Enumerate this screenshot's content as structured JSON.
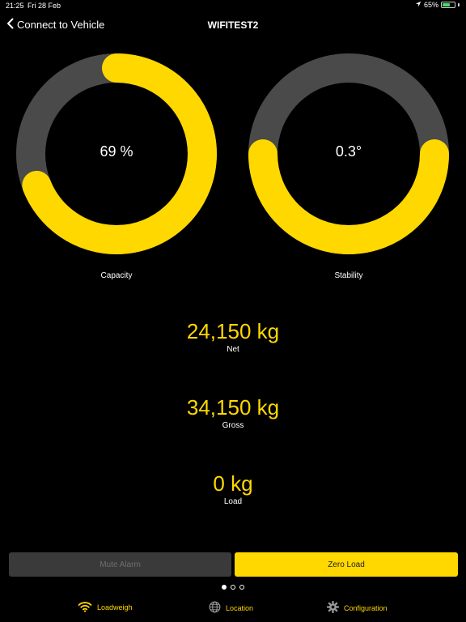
{
  "status_bar": {
    "time": "21:25",
    "date": "Fri 28 Feb",
    "battery": "65%",
    "battery_level": 0.65
  },
  "nav": {
    "back_label": "Connect to Vehicle",
    "title": "WIFITEST2"
  },
  "gauges": {
    "capacity": {
      "value": "69 %",
      "label": "Capacity",
      "fill_percent": 69
    },
    "stability": {
      "value": "0.3°",
      "label": "Stability"
    }
  },
  "readings": {
    "net": {
      "value": "24,150 kg",
      "label": "Net"
    },
    "gross": {
      "value": "34,150 kg",
      "label": "Gross"
    },
    "load": {
      "value": "0 kg",
      "label": "Load"
    }
  },
  "actions": {
    "mute_label": "Mute Alarm",
    "zero_label": "Zero Load"
  },
  "pager": {
    "count": 3,
    "current": 1
  },
  "tabs": [
    {
      "label": "Loadweigh",
      "icon": "wifi-icon",
      "active": true
    },
    {
      "label": "Location",
      "icon": "globe-icon",
      "active": false
    },
    {
      "label": "Configuration",
      "icon": "gear-icon",
      "active": false
    }
  ],
  "colors": {
    "accent": "#ffd800",
    "track": "#4a4a4a",
    "background": "#000000"
  }
}
